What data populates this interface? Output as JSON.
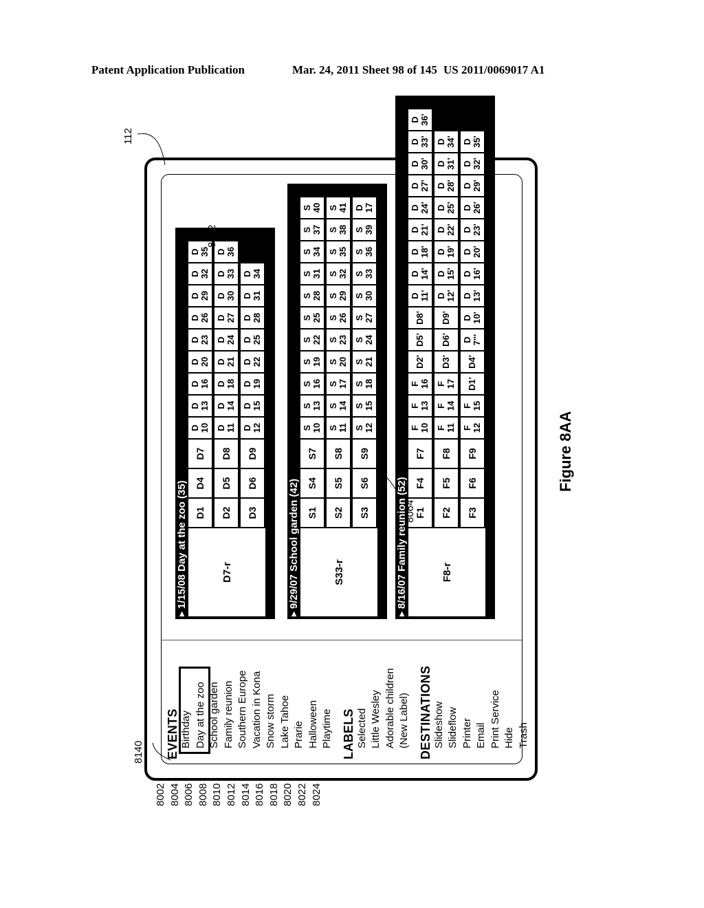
{
  "header": {
    "left": "Patent Application Publication",
    "middle": "Mar. 24, 2011  Sheet 98 of 145",
    "right": "US 2011/0069017 A1"
  },
  "figure_label": "Figure 8AA",
  "refs": {
    "device": "112",
    "selection_cursor": "8140",
    "first_panel": "8052",
    "second_panel": "8064",
    "events_items": [
      "8002",
      "8004",
      "8006",
      "8008",
      "8010",
      "8012",
      "8014",
      "8016",
      "8018",
      "8020",
      "8022",
      "8024"
    ]
  },
  "sidebar": {
    "events_heading": "EVENTS",
    "events": [
      "Birthday",
      "Day at the zoo",
      "School garden",
      "Family reunion",
      "Southern Europe",
      "Vacation in Kona",
      "Snow storm",
      "Lake Tahoe",
      "Prarie",
      "Halloween",
      "Playtime"
    ],
    "labels_heading": "LABELS",
    "labels": [
      "Selected",
      "Little Wesley",
      "Adorable children",
      "(New Label)"
    ],
    "destinations_heading": "DESTINATIONS",
    "destinations": [
      "Slideshow",
      "Slideflow",
      "Printer",
      "Email",
      "Print Service",
      "Hide",
      "Trash"
    ]
  },
  "panels": [
    {
      "title": "1/15/08 Day at the zoo (35)",
      "hero": "D7-r",
      "rows": [
        {
          "big": [
            "D1",
            "D4",
            "D7"
          ],
          "small": [
            [
              "D",
              "10"
            ],
            [
              "D",
              "13"
            ],
            [
              "D",
              "16"
            ],
            [
              "D",
              "20"
            ],
            [
              "D",
              "23"
            ],
            [
              "D",
              "26"
            ],
            [
              "D",
              "29"
            ],
            [
              "D",
              "32"
            ],
            [
              "D",
              "35"
            ]
          ]
        },
        {
          "big": [
            "D2",
            "D5",
            "D8"
          ],
          "small": [
            [
              "D",
              "11"
            ],
            [
              "D",
              "14"
            ],
            [
              "D",
              "18"
            ],
            [
              "D",
              "21"
            ],
            [
              "D",
              "24"
            ],
            [
              "D",
              "27"
            ],
            [
              "D",
              "30"
            ],
            [
              "D",
              "33"
            ],
            [
              "D",
              "36"
            ]
          ]
        },
        {
          "big": [
            "D3",
            "D6",
            "D9"
          ],
          "small": [
            [
              "D",
              "12"
            ],
            [
              "D",
              "15"
            ],
            [
              "D",
              "19"
            ],
            [
              "D",
              "22"
            ],
            [
              "D",
              "25"
            ],
            [
              "D",
              "28"
            ],
            [
              "D",
              "31"
            ],
            [
              "D",
              "34"
            ]
          ]
        }
      ]
    },
    {
      "title": "9/29/07 School garden (42)",
      "hero": "S33-r",
      "rows": [
        {
          "big": [
            "S1",
            "S4",
            "S7"
          ],
          "small": [
            [
              "S",
              "10"
            ],
            [
              "S",
              "13"
            ],
            [
              "S",
              "16"
            ],
            [
              "S",
              "19"
            ],
            [
              "S",
              "22"
            ],
            [
              "S",
              "25"
            ],
            [
              "S",
              "28"
            ],
            [
              "S",
              "31"
            ],
            [
              "S",
              "34"
            ],
            [
              "S",
              "37"
            ],
            [
              "S",
              "40"
            ]
          ]
        },
        {
          "big": [
            "S2",
            "S5",
            "S8"
          ],
          "small": [
            [
              "S",
              "11"
            ],
            [
              "S",
              "14"
            ],
            [
              "S",
              "17"
            ],
            [
              "S",
              "20"
            ],
            [
              "S",
              "23"
            ],
            [
              "S",
              "26"
            ],
            [
              "S",
              "29"
            ],
            [
              "S",
              "32"
            ],
            [
              "S",
              "35"
            ],
            [
              "S",
              "38"
            ],
            [
              "S",
              "41"
            ]
          ]
        },
        {
          "big": [
            "S3",
            "S6",
            "S9"
          ],
          "small": [
            [
              "S",
              "12"
            ],
            [
              "S",
              "15"
            ],
            [
              "S",
              "18"
            ],
            [
              "S",
              "21"
            ],
            [
              "S",
              "24"
            ],
            [
              "S",
              "27"
            ],
            [
              "S",
              "30"
            ],
            [
              "S",
              "33"
            ],
            [
              "S",
              "36"
            ],
            [
              "S",
              "39"
            ],
            [
              "D",
              "17"
            ]
          ]
        }
      ]
    },
    {
      "title": "8/16/07 Family reunion (52)",
      "hero": "F8-r",
      "rows": [
        {
          "big": [
            "F1",
            "F4",
            "F7"
          ],
          "small": [
            [
              "F",
              "10"
            ],
            [
              "F",
              "13"
            ],
            [
              "F",
              "16"
            ],
            [
              "D2'",
              ""
            ],
            [
              "D5'",
              ""
            ],
            [
              "D8'",
              ""
            ],
            [
              "D",
              "11'"
            ],
            [
              "D",
              "14'"
            ],
            [
              "D",
              "18'"
            ],
            [
              "D",
              "21'"
            ],
            [
              "D",
              "24'"
            ],
            [
              "D",
              "27'"
            ],
            [
              "D",
              "30'"
            ],
            [
              "D",
              "33'"
            ],
            [
              "D",
              "36'"
            ]
          ]
        },
        {
          "big": [
            "F2",
            "F5",
            "F8"
          ],
          "small": [
            [
              "F",
              "11"
            ],
            [
              "F",
              "14"
            ],
            [
              "F",
              "17"
            ],
            [
              "D3'",
              ""
            ],
            [
              "D6'",
              ""
            ],
            [
              "D9'",
              ""
            ],
            [
              "D",
              "12'"
            ],
            [
              "D",
              "15'"
            ],
            [
              "D",
              "19'"
            ],
            [
              "D",
              "22'"
            ],
            [
              "D",
              "25'"
            ],
            [
              "D",
              "28'"
            ],
            [
              "D",
              "31'"
            ],
            [
              "D",
              "34'"
            ]
          ]
        },
        {
          "big": [
            "F3",
            "F6",
            "F9"
          ],
          "small": [
            [
              "F",
              "12"
            ],
            [
              "F",
              "15"
            ],
            [
              "D1'",
              ""
            ],
            [
              "D4'",
              ""
            ],
            [
              "D",
              "7'''"
            ],
            [
              "D",
              "10'"
            ],
            [
              "D",
              "13'"
            ],
            [
              "D",
              "16'"
            ],
            [
              "D",
              "20'"
            ],
            [
              "D",
              "23'"
            ],
            [
              "D",
              "26'"
            ],
            [
              "D",
              "29'"
            ],
            [
              "D",
              "32'"
            ],
            [
              "D",
              "35'"
            ]
          ]
        }
      ]
    }
  ]
}
